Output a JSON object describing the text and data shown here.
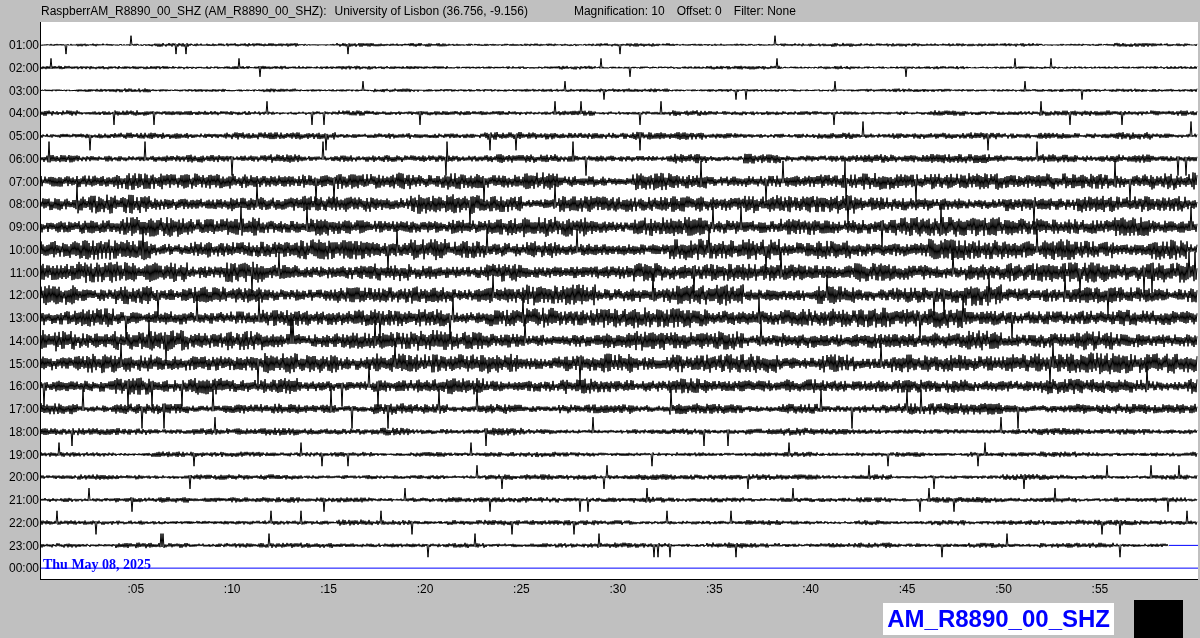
{
  "header": {
    "channel": "RaspberrAM_R8890_00_SHZ (AM_R8890_00_SHZ):",
    "location": "University of Lisbon (36.756, -9.156)",
    "magnification": "Magnification: 10",
    "offset": "Offset: 0",
    "filter": "Filter: None"
  },
  "rows": [
    "01:00",
    "02:00",
    "03:00",
    "04:00",
    "05:00",
    "06:00",
    "07:00",
    "08:00",
    "09:00",
    "10:00",
    "11:00",
    "12:00",
    "13:00",
    "14:00",
    "15:00",
    "16:00",
    "17:00",
    "18:00",
    "19:00",
    "20:00",
    "21:00",
    "22:00",
    "23:00",
    "00:00"
  ],
  "date_label": "Thu May 08, 2025",
  "x_ticks": [
    ":05",
    ":10",
    ":15",
    ":20",
    ":25",
    ":30",
    ":35",
    ":40",
    ":45",
    ":50",
    ":55"
  ],
  "station_label": "AM_R8890_00_SHZ"
}
